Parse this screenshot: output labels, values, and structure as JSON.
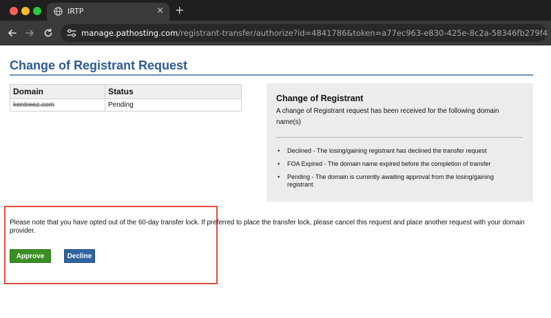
{
  "browser": {
    "tab_title": "IRTP",
    "tab_close": "×",
    "new_tab": "+",
    "url_host": "manage.pathosting.com",
    "url_rest": "/registrant-transfer/authorize?id=4841786&token=a77ec963-e830-425e-8c2a-58346fb279f4"
  },
  "page": {
    "title": "Change of Registrant Request"
  },
  "table": {
    "headers": [
      "Domain",
      "Status"
    ],
    "rows": [
      {
        "domain": "kentreez.com",
        "status": "Pending"
      }
    ]
  },
  "info": {
    "title": "Change of Registrant",
    "description": "A change of Registrant request has been received for the following domain name(s)",
    "items": [
      "Declined - The losing/gaining registrant has declined the transfer request",
      "FOA Expired - The domain name expired before the completion of transfer",
      "Pending - The domain is currently awaiting approval from the losing/gaining registrant"
    ]
  },
  "notice": "Please note that you have opted out of the 60-day transfer lock. If preferred to place the transfer lock, please cancel this request and place another request with your domain provider.",
  "actions": {
    "approve": "Approve",
    "decline": "Decline"
  },
  "colors": {
    "title": "#2b5a96",
    "approve": "#3b8f23",
    "decline": "#2e64a0",
    "highlight": "#e24a38"
  },
  "icons": [
    "globe-icon",
    "back-arrow-icon",
    "forward-arrow-icon",
    "reload-icon",
    "site-settings-icon"
  ]
}
